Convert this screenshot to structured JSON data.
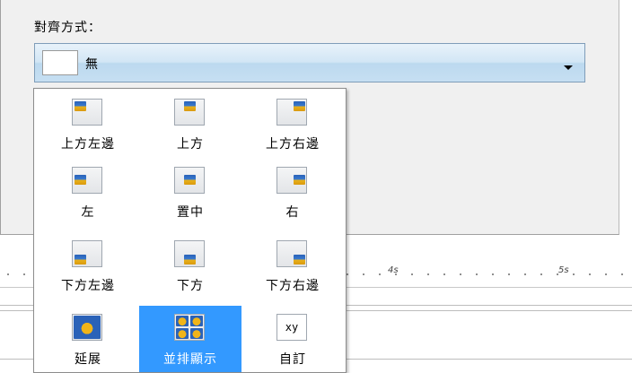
{
  "dialog": {
    "alignment_label": "對齊方式：",
    "dropdown": {
      "selected_value": "無"
    }
  },
  "timeline": {
    "ticks": [
      "4s",
      "5s"
    ]
  },
  "popup": {
    "options": [
      {
        "label": "上方左邊",
        "icon": "align-top-left-icon"
      },
      {
        "label": "上方",
        "icon": "align-top-icon"
      },
      {
        "label": "上方右邊",
        "icon": "align-top-right-icon"
      },
      {
        "label": "左",
        "icon": "align-left-icon"
      },
      {
        "label": "置中",
        "icon": "align-center-icon"
      },
      {
        "label": "右",
        "icon": "align-right-icon"
      },
      {
        "label": "下方左邊",
        "icon": "align-bottom-left-icon"
      },
      {
        "label": "下方",
        "icon": "align-bottom-icon"
      },
      {
        "label": "下方右邊",
        "icon": "align-bottom-right-icon"
      },
      {
        "label": "延展",
        "icon": "stretch-icon"
      },
      {
        "label": "並排顯示",
        "icon": "tile-icon",
        "selected": true
      },
      {
        "label": "自訂",
        "icon": "custom-xy-icon",
        "glyph": "xy"
      }
    ],
    "selected_color": "#3399ff"
  }
}
